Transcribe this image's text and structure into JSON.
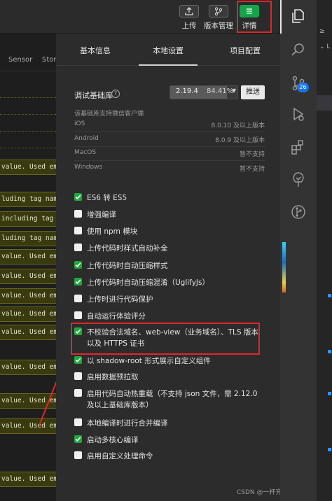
{
  "toolbar": {
    "buttons": [
      {
        "label": "上传",
        "icon": "upload-icon"
      },
      {
        "label": "版本管理",
        "icon": "git-branch-icon"
      },
      {
        "label": "详情",
        "icon": "menu-icon"
      }
    ]
  },
  "console": {
    "tabs": [
      "Sensor",
      "Stora"
    ],
    "lines": [
      "value. Used empt",
      "luding tag name",
      " including tag",
      "luding tag name",
      "value. Used empt",
      "value. Used empt",
      "value. Used empt",
      "value. Used empt",
      "value. Used empt",
      "value. Used empt",
      "value. Used empt",
      "value. Used empt",
      "value. Used empt"
    ]
  },
  "details": {
    "tabs": [
      "基本信息",
      "本地设置",
      "项目配置"
    ],
    "active_tab": "本地设置",
    "base_lib": {
      "label": "调试基础库",
      "version": "2.19.4",
      "percent": "84.41%",
      "percent_value": 84.41,
      "push_label": "推送"
    },
    "support": {
      "title": "该基础库支持微信客户端",
      "rows": [
        {
          "os": "iOS",
          "value": "8.0.10 及以上版本"
        },
        {
          "os": "Android",
          "value": "8.0.9 及以上版本"
        },
        {
          "os": "MacOS",
          "value": "暂不支持"
        },
        {
          "os": "Windows",
          "value": "暂不支持"
        }
      ]
    },
    "options": [
      {
        "label": "ES6 转 ES5",
        "checked": true
      },
      {
        "label": "增强编译",
        "checked": false
      },
      {
        "label": "使用 npm 模块",
        "checked": false
      },
      {
        "label": "上传代码时样式自动补全",
        "checked": false
      },
      {
        "label": "上传代码时自动压缩样式",
        "checked": true
      },
      {
        "label": "上传代码时自动压缩混淆（UglifyJs）",
        "checked": true
      },
      {
        "label": "上传时进行代码保护",
        "checked": false
      },
      {
        "label": "自动运行体验评分",
        "checked": false
      },
      {
        "label": "不校验合法域名、web-view（业务域名）、TLS 版本以及 HTTPS 证书",
        "checked": true
      },
      {
        "label": "以 shadow-root 形式展示自定义组件",
        "checked": true
      },
      {
        "label": "启用数据预拉取",
        "checked": false
      },
      {
        "label": "启用代码自动热重载（不支持 json 文件，需 2.12.0 及以上基础库版本）",
        "checked": false
      },
      {
        "label": "本地编译时进行合并编译",
        "checked": false
      },
      {
        "label": "启动多核心编译",
        "checked": true
      },
      {
        "label": "启用自定义处理命令",
        "checked": false
      }
    ]
  },
  "activity_bar": {
    "icons": [
      "files-icon",
      "search-icon",
      "source-control-icon",
      "run-debug-icon",
      "extensions-icon",
      "tree-icon",
      "git-graph-icon"
    ],
    "badge": "26"
  },
  "explorer": {
    "lines": [
      "≥",
      "⌄ L"
    ]
  },
  "watermark": "CSDN @一杯充满泡泡的可乐",
  "colors": {
    "accent_green": "#1fa83c",
    "highlight_red": "#e0262b",
    "badge_blue": "#1a73e8"
  }
}
